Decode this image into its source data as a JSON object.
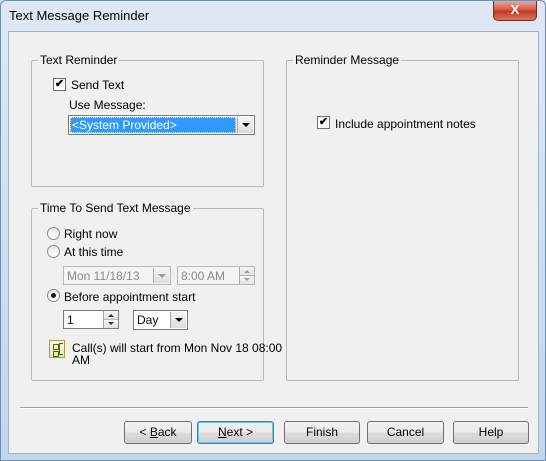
{
  "window": {
    "title": "Text Message Reminder",
    "close_glyph": "X"
  },
  "text_reminder": {
    "group_title": "Text Reminder",
    "send_text_label": "Send Text",
    "send_text_checked": true,
    "use_message_label": "Use Message:",
    "use_message_value": "<System Provided>"
  },
  "reminder_message": {
    "group_title": "Reminder Message",
    "include_notes_label": "Include appointment notes",
    "include_notes_checked": true
  },
  "time_to_send": {
    "group_title": "Time To Send Text Message",
    "right_now_label": "Right now",
    "at_this_time_label": "At this time",
    "date_value": "Mon 11/18/13",
    "time_value": "8:00 AM",
    "before_start_label": "Before appointment start",
    "selected_option": "before_start",
    "offset_value": "1",
    "offset_unit": "Day",
    "info_text_line1": "Call(s) will start from Mon Nov 18 08:00",
    "info_text_line2": "AM"
  },
  "buttons": {
    "back_label_accel": "B",
    "back_label_prefix": "< ",
    "back_label_rest": "ack",
    "next_label_accel": "N",
    "next_label_rest": "ext >",
    "finish_label": "Finish",
    "cancel_label": "Cancel",
    "help_label": "Help"
  },
  "icons": {
    "check_glyph": "✔",
    "info_icon": "schedule-info-icon"
  }
}
